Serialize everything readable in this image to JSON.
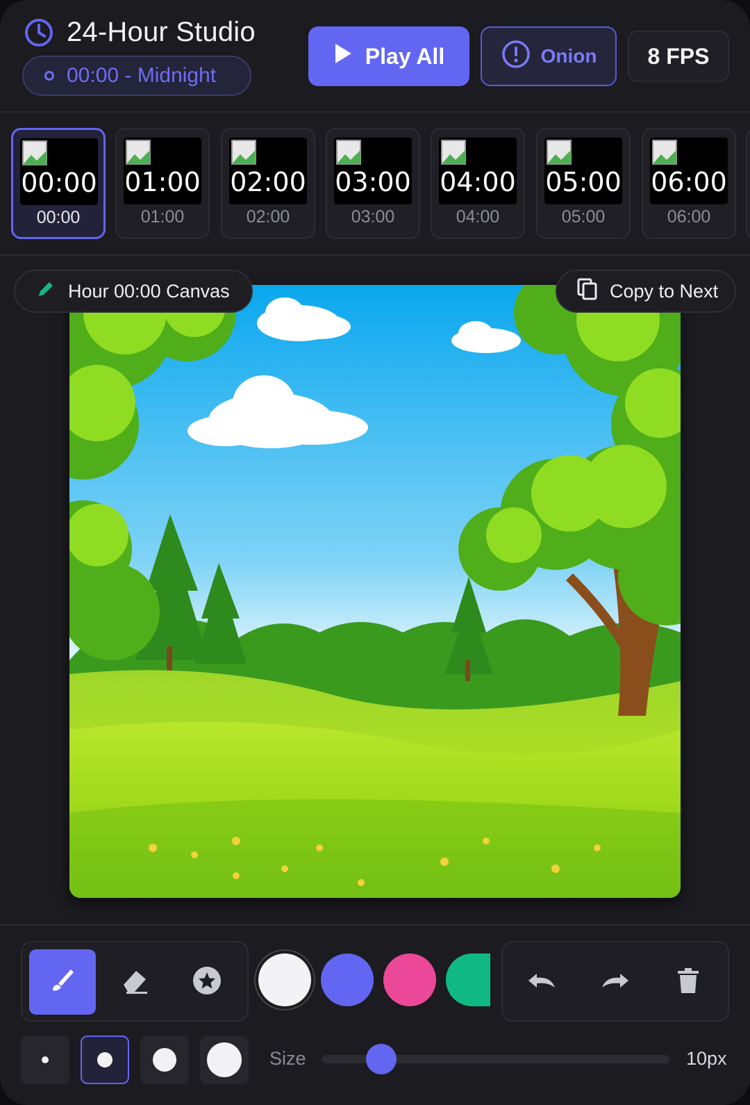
{
  "header": {
    "title": "24-Hour Studio",
    "current_hour": "00:00 - Midnight",
    "play_all_label": "Play All",
    "onion_label": "Onion",
    "fps_label": "8 FPS"
  },
  "timeline": {
    "frames": [
      {
        "thumb_text": "00:00",
        "label": "00:00",
        "active": true
      },
      {
        "thumb_text": "01:00",
        "label": "01:00",
        "active": false
      },
      {
        "thumb_text": "02:00",
        "label": "02:00",
        "active": false
      },
      {
        "thumb_text": "03:00",
        "label": "03:00",
        "active": false
      },
      {
        "thumb_text": "04:00",
        "label": "04:00",
        "active": false
      },
      {
        "thumb_text": "05:00",
        "label": "05:00",
        "active": false
      },
      {
        "thumb_text": "06:00",
        "label": "06:00",
        "active": false
      }
    ]
  },
  "canvas": {
    "label": "Hour 00:00 Canvas",
    "copy_label": "Copy to Next"
  },
  "toolbar": {
    "tools": [
      {
        "name": "brush-icon",
        "active": true
      },
      {
        "name": "eraser-icon",
        "active": false
      },
      {
        "name": "star-stamp-icon",
        "active": false
      }
    ],
    "colors": [
      "#f3f3f5",
      "#6366f1",
      "#ec4899",
      "#10b981"
    ],
    "selected_color": "#f3f3f5",
    "history": [
      "undo-icon",
      "redo-icon",
      "trash-icon"
    ],
    "size_label": "Size",
    "size_value": "10px",
    "size_fraction": 0.17,
    "brush_presets": [
      "small",
      "medium",
      "large",
      "x-large"
    ],
    "active_preset": 1
  },
  "colors": {
    "accent": "#6366f1",
    "background": "#1b1b20",
    "panel": "#1f1f25"
  }
}
